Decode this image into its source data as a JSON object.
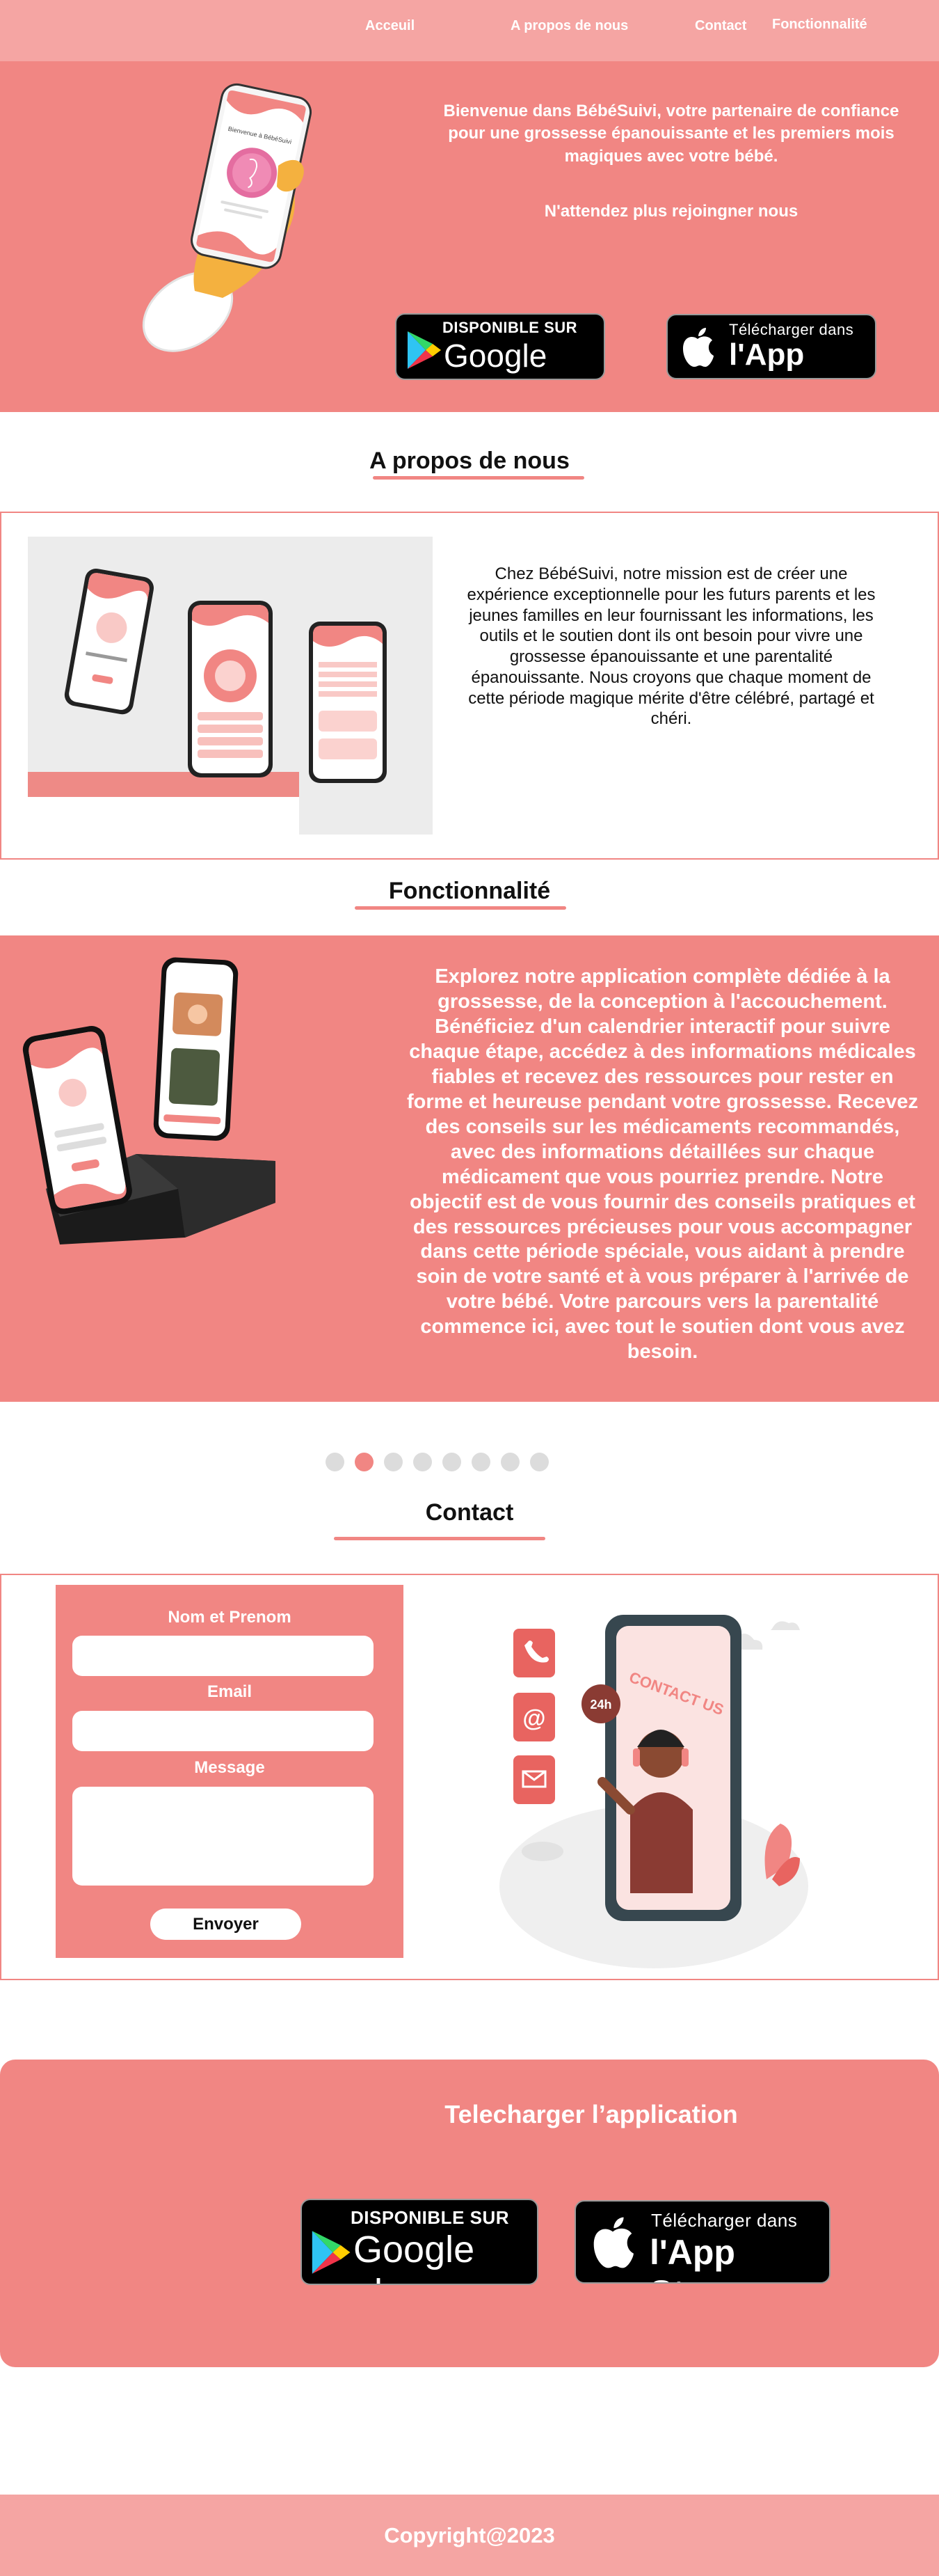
{
  "nav": {
    "items": [
      "Acceuil",
      "A propos de nous",
      "Contact",
      "Fonctionnalité"
    ]
  },
  "hero": {
    "intro": "Bienvenue dans BébéSuivi, votre partenaire de confiance pour une grossesse épanouissante et les premiers mois magiques avec votre bébé.",
    "cta": "N'attendez plus rejoingner nous"
  },
  "badges": {
    "google_small": "DISPONIBLE SUR",
    "google_big": "Google play",
    "apple_small": "Télécharger dans",
    "apple_big": "l'App Store"
  },
  "phone_screen_text": "Bienvenue à BébéSuivi",
  "about": {
    "title": "A propos de nous",
    "text": "Chez BébéSuivi, notre mission est de créer une expérience exceptionnelle pour les futurs parents et les jeunes familles en leur fournissant les informations, les outils et le soutien dont ils ont besoin pour vivre une grossesse épanouissante et une parentalité épanouissante. Nous croyons que chaque moment de cette période magique mérite d'être célébré, partagé et chéri."
  },
  "features": {
    "title": "Fonctionnalité",
    "text": "Explorez notre application complète dédiée à la grossesse, de la conception à l'accouchement. Bénéficiez d'un calendrier interactif pour suivre chaque étape, accédez à des informations médicales fiables et recevez des ressources pour rester en forme et heureuse pendant votre grossesse. Recevez des conseils sur les médicaments recommandés, avec des informations détaillées sur chaque médicament que vous pourriez prendre. Notre objectif est de vous fournir des conseils pratiques et des ressources précieuses pour vous accompagner dans cette période spéciale, vous aidant à prendre soin de votre santé et à vous préparer à l'arrivée de votre bébé. Votre parcours vers la parentalité commence ici, avec tout le soutien dont vous avez besoin."
  },
  "carousel": {
    "count": 8,
    "active_index": 1
  },
  "contact": {
    "title": "Contact",
    "name_label": "Nom et Prenom",
    "email_label": "Email",
    "message_label": "Message",
    "send_label": "Envoyer",
    "illustration_text": "CONTACT US",
    "badge_24h": "24h"
  },
  "download": {
    "title": "Telecharger l’application"
  },
  "footer": {
    "copyright": "Copyright@2023"
  },
  "colors": {
    "primary": "#f18683",
    "nav": "#f5a5a3",
    "dot": "#dcdcdc"
  }
}
